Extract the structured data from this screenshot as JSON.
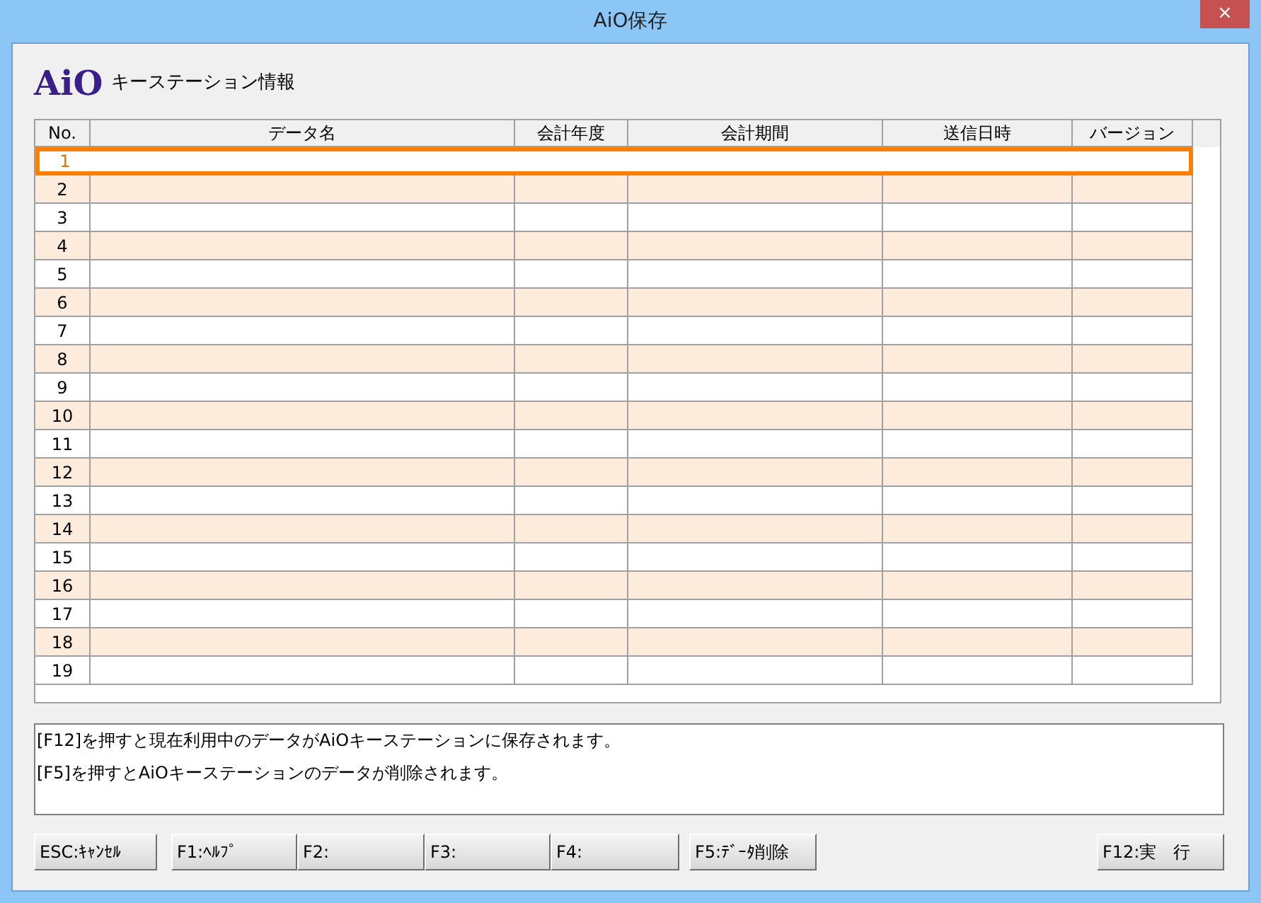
{
  "window": {
    "title": "AiO保存",
    "close": "×"
  },
  "header": {
    "logo": "AiO",
    "title": "キーステーション情報"
  },
  "table": {
    "columns": [
      "No.",
      "データ名",
      "会計年度",
      "会計期間",
      "送信日時",
      "バージョン"
    ],
    "rows": [
      {
        "no": "1",
        "selected": true
      },
      {
        "no": "2",
        "selected": false
      },
      {
        "no": "3",
        "selected": false
      },
      {
        "no": "4",
        "selected": false
      },
      {
        "no": "5",
        "selected": false
      },
      {
        "no": "6",
        "selected": false
      },
      {
        "no": "7",
        "selected": false
      },
      {
        "no": "8",
        "selected": false
      },
      {
        "no": "9",
        "selected": false
      },
      {
        "no": "10",
        "selected": false
      },
      {
        "no": "11",
        "selected": false
      },
      {
        "no": "12",
        "selected": false
      },
      {
        "no": "13",
        "selected": false
      },
      {
        "no": "14",
        "selected": false
      },
      {
        "no": "15",
        "selected": false
      },
      {
        "no": "16",
        "selected": false
      },
      {
        "no": "17",
        "selected": false
      },
      {
        "no": "18",
        "selected": false
      },
      {
        "no": "19",
        "selected": false
      }
    ]
  },
  "messages": [
    "[F12]を押すと現在利用中のデータがAiOキーステーションに保存されます。",
    "[F5]を押すとAiOキーステーションのデータが削除されます。"
  ],
  "buttons": [
    {
      "label": "ESC:ｷｬﾝｾﾙ",
      "kind": "left"
    },
    {
      "label": "F1:ﾍﾙﾌﾟ",
      "kind": "left"
    },
    {
      "label": "F2:",
      "kind": "left"
    },
    {
      "label": "F3:",
      "kind": "left"
    },
    {
      "label": "F4:",
      "kind": "left"
    },
    {
      "label": "F5:ﾃﾞｰﾀ削除",
      "kind": "left"
    },
    {
      "label": "F12:実　行",
      "kind": "right"
    }
  ]
}
